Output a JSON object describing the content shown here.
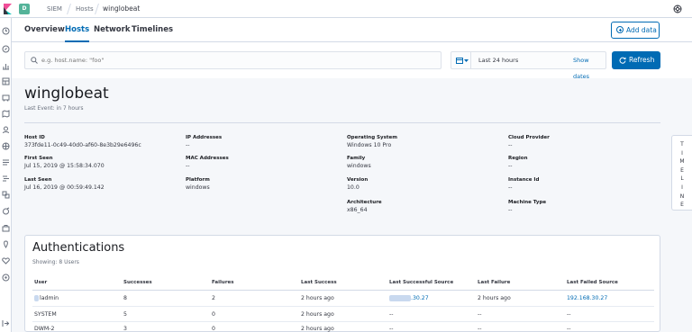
{
  "breadcrumbs": [
    "SIEM",
    "Hosts",
    "winglobeat"
  ],
  "space_badge": "D",
  "tabs": [
    "Overview",
    "Hosts",
    "Network",
    "Timelines"
  ],
  "active_tab": "Hosts",
  "add_data_label": "Add data",
  "search": {
    "placeholder": "e.g. host.name: \"foo\""
  },
  "date_range": {
    "label": "Last 24 hours",
    "show_dates": "Show dates"
  },
  "refresh_label": "Refresh",
  "host": {
    "name": "winglobeat",
    "last_event": "Last Event: in 7 hours"
  },
  "overview": {
    "host_id": {
      "title": "Host ID",
      "value": "373fde11-0c49-40d0-af60-8e3b29e6496c"
    },
    "first_seen": {
      "title": "First Seen",
      "value": "Jul 15, 2019 @ 15:58:34.070"
    },
    "last_seen": {
      "title": "Last Seen",
      "value": "Jul 16, 2019 @ 00:59:49.142"
    },
    "ip_addresses": {
      "title": "IP Addresses",
      "value": "--"
    },
    "mac_addresses": {
      "title": "MAC Addresses",
      "value": "--"
    },
    "platform": {
      "title": "Platform",
      "value": "windows"
    },
    "os": {
      "title": "Operating System",
      "value": "Windows 10 Pro"
    },
    "family": {
      "title": "Family",
      "value": "windows"
    },
    "version": {
      "title": "Version",
      "value": "10.0"
    },
    "architecture": {
      "title": "Architecture",
      "value": "x86_64"
    },
    "cloud_provider": {
      "title": "Cloud Provider",
      "value": "--"
    },
    "region": {
      "title": "Region",
      "value": "--"
    },
    "instance_id": {
      "title": "Instance Id",
      "value": "--"
    },
    "machine_type": {
      "title": "Machine Type",
      "value": "--"
    }
  },
  "timeline_label": [
    "T",
    "I",
    "M",
    "E",
    "L",
    "I",
    "N",
    "E"
  ],
  "auth": {
    "title": "Authentications",
    "subtitle": "Showing: 8 Users",
    "columns": [
      "User",
      "Successes",
      "Failures",
      "Last Success",
      "Last Successful Source",
      "Last Failure",
      "Last Failed Source"
    ],
    "rows": [
      [
        "ladmin",
        "8",
        "2",
        "2 hours ago",
        ".30.27",
        "2 hours ago",
        "192.168.30.27"
      ],
      [
        "SYSTEM",
        "5",
        "0",
        "2 hours ago",
        "--",
        "--",
        "--"
      ],
      [
        "DWM-2",
        "3",
        "0",
        "2 hours ago",
        "--",
        "--",
        "--"
      ]
    ]
  },
  "colors": {
    "accent": "#006bb4",
    "badge": "#54b399"
  }
}
